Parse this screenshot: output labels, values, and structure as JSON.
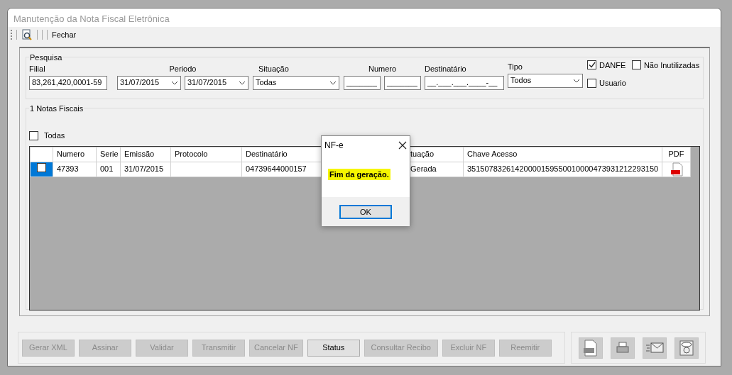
{
  "window": {
    "title": "Manutenção da Nota Fiscal Eletrônica"
  },
  "toolbar": {
    "close_label": "Fechar"
  },
  "search": {
    "title": "Pesquisa",
    "filial": {
      "label": "Filial",
      "value": "83,261,420,0001-59"
    },
    "periodo": {
      "label": "Periodo",
      "from": "31/07/2015",
      "to": "31/07/2015"
    },
    "situacao": {
      "label": "Situação",
      "value": "Todas"
    },
    "numero": {
      "label": "Numero",
      "from": "_______",
      "to": "_______"
    },
    "destinatario": {
      "label": "Destinatário",
      "value": "__.___.___.____-__"
    },
    "tipo": {
      "label": "Tipo",
      "value": "Todos"
    },
    "checks": [
      {
        "label": "DANFE",
        "checked": true
      },
      {
        "label": "Não Inutilizadas",
        "checked": false
      },
      {
        "label": "Usuario",
        "checked": false
      }
    ]
  },
  "list": {
    "title": "1 Notas Fiscais",
    "select_all": {
      "label": "Todas",
      "checked": false
    },
    "columns": [
      "Numero",
      "Serie",
      "Emissão",
      "Protocolo",
      "Destinatário",
      "tuação",
      "Chave Acesso",
      "PDF"
    ],
    "rows": [
      {
        "selected": true,
        "checked": false,
        "cells": [
          "47393",
          "001",
          "31/07/2015",
          "",
          "04739644000157",
          "Gerada",
          "35150783261420000159550010000473931212293150"
        ]
      }
    ]
  },
  "buttons": [
    {
      "label": "Gerar XML",
      "disabled": true
    },
    {
      "label": "Assinar",
      "disabled": true
    },
    {
      "label": "Validar",
      "disabled": true
    },
    {
      "label": "Transmitir",
      "disabled": true
    },
    {
      "label": "Cancelar NF",
      "disabled": true
    },
    {
      "label": "Status",
      "disabled": false
    },
    {
      "label": "Consultar Recibo",
      "disabled": true
    },
    {
      "label": "Excluir NF",
      "disabled": true
    },
    {
      "label": "Reemitir",
      "disabled": true
    }
  ],
  "dialog": {
    "title": "NF-e",
    "message": "Fim da geração.",
    "button": "OK"
  }
}
